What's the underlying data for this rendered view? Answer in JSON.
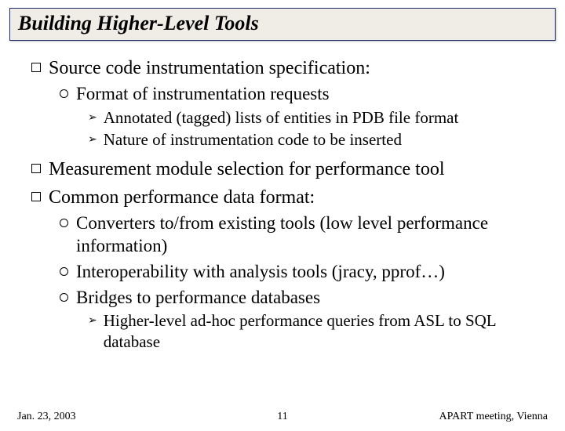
{
  "title": "Building Higher-Level Tools",
  "bullets": {
    "b1": "Source code instrumentation specification:",
    "b1_1": "Format of instrumentation requests",
    "b1_1_1": "Annotated (tagged) lists of entities in PDB file format",
    "b1_1_2": "Nature of instrumentation code to be inserted",
    "b2": "Measurement module selection for performance tool",
    "b3": "Common performance data format:",
    "b3_1": "Converters to/from existing tools (low level performance information)",
    "b3_2": "Interoperability with analysis tools (jracy, pprof…)",
    "b3_3": "Bridges to performance databases",
    "b3_3_1": "Higher-level ad-hoc performance queries from ASL to SQL database"
  },
  "footer": {
    "date": "Jan. 23, 2003",
    "page": "11",
    "venue": "APART meeting, Vienna"
  }
}
